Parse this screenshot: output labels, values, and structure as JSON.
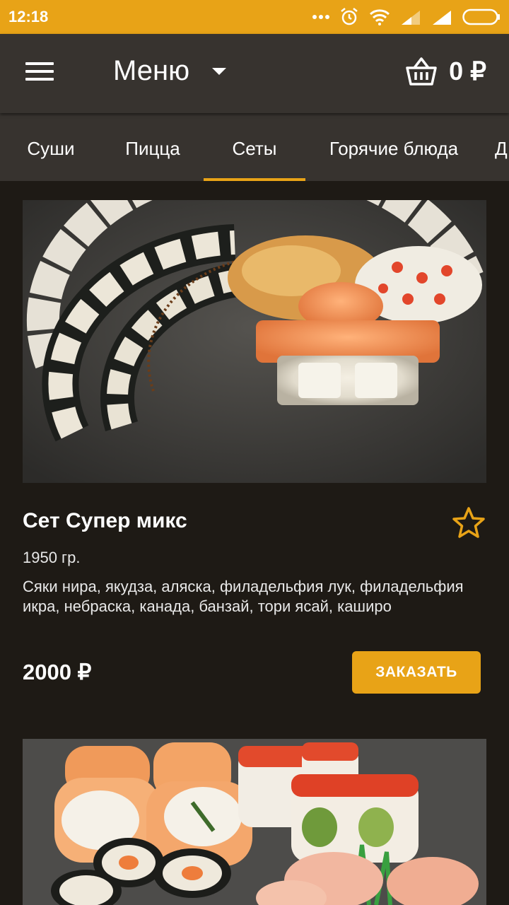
{
  "status_bar": {
    "time": "12:18"
  },
  "app_bar": {
    "title": "Меню",
    "cart_total": "0 ₽"
  },
  "tabs": [
    {
      "label": "Суши",
      "active": false
    },
    {
      "label": "Пицца",
      "active": false
    },
    {
      "label": "Сеты",
      "active": true
    },
    {
      "label": "Горячие блюда",
      "active": false
    },
    {
      "label": "Д",
      "active": false
    }
  ],
  "products": [
    {
      "name": "Сет Супер микс",
      "weight": "1950 гр.",
      "description": "Сяки нира, якудза, аляска, филадельфия лук, филадельфия икра, небраска, канада, банзай, тори ясай, каширо",
      "price": "2000 ₽",
      "order_label": "ЗАКАЗАТЬ"
    }
  ],
  "colors": {
    "accent": "#e8a317",
    "app_bar": "#37332f",
    "background": "#1e1a15"
  }
}
